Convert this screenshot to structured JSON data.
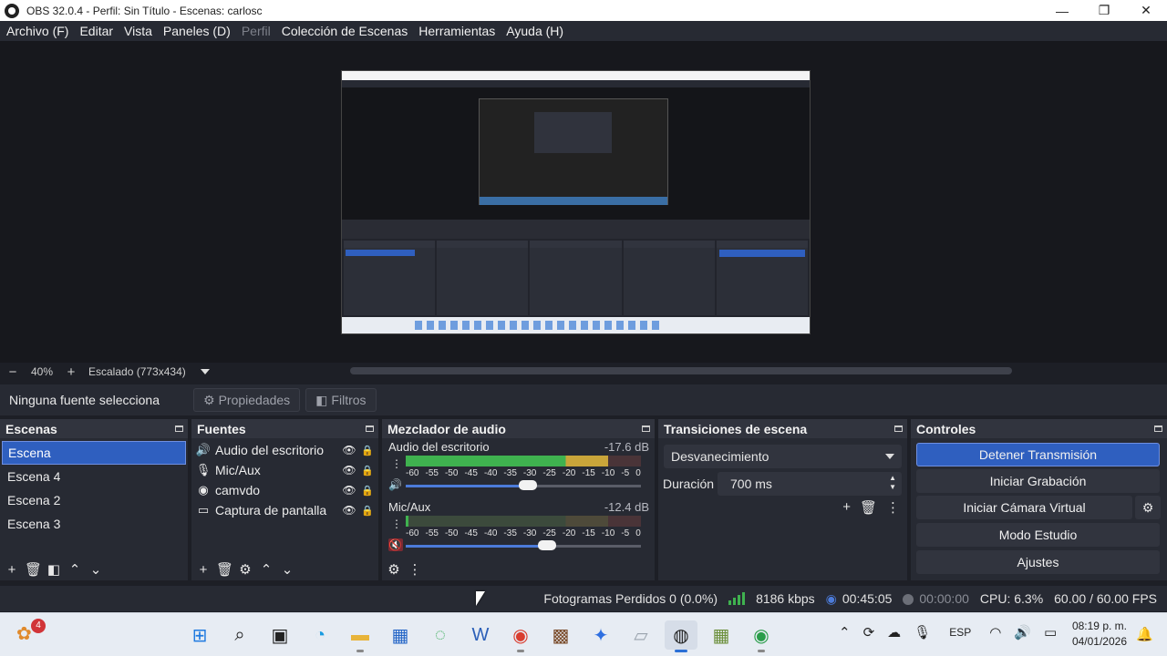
{
  "window": {
    "title": "OBS 32.0.4 - Perfil: Sin Título - Escenas: carlosc",
    "controls": [
      "—",
      "❐",
      "✕"
    ]
  },
  "menu": [
    {
      "label": "Archivo (F)",
      "enabled": true
    },
    {
      "label": "Editar",
      "enabled": true
    },
    {
      "label": "Vista",
      "enabled": true
    },
    {
      "label": "Paneles (D)",
      "enabled": true
    },
    {
      "label": "Perfil",
      "enabled": false
    },
    {
      "label": "Colección de Escenas",
      "enabled": true
    },
    {
      "label": "Herramientas",
      "enabled": true
    },
    {
      "label": "Ayuda (H)",
      "enabled": true
    }
  ],
  "zoom": {
    "minus": "−",
    "percent": "40%",
    "plus": "+",
    "scale_label": "Escalado (773x434)"
  },
  "source_toolbar": {
    "no_selection": "Ninguna fuente selecciona",
    "properties": "Propiedades",
    "filters": "Filtros"
  },
  "scenes": {
    "title": "Escenas",
    "items": [
      {
        "label": "Escena",
        "selected": true
      },
      {
        "label": "Escena 4",
        "selected": false
      },
      {
        "label": "Escena 2",
        "selected": false
      },
      {
        "label": "Escena 3",
        "selected": false
      }
    ]
  },
  "sources": {
    "title": "Fuentes",
    "items": [
      {
        "label": "Audio del escritorio",
        "icon": "speaker-icon"
      },
      {
        "label": "Mic/Aux",
        "icon": "microphone-icon"
      },
      {
        "label": "camvdo",
        "icon": "browser-icon"
      },
      {
        "label": "Captura de pantalla",
        "icon": "monitor-icon"
      }
    ]
  },
  "mixer": {
    "title": "Mezclador de audio",
    "ticks": [
      "-60",
      "-55",
      "-50",
      "-45",
      "-40",
      "-35",
      "-30",
      "-25",
      "-20",
      "-15",
      "-10",
      "-5",
      "0"
    ],
    "channels": [
      {
        "name": "Audio del escritorio",
        "db": "-17.6 dB",
        "level": 0.86,
        "volume": 0.52,
        "muted": false
      },
      {
        "name": "Mic/Aux",
        "db": "-12.4 dB",
        "level": 0.01,
        "volume": 0.6,
        "muted": true
      }
    ]
  },
  "transitions": {
    "title": "Transiciones de escena",
    "selected": "Desvanecimiento",
    "duration_label": "Duración",
    "duration_value": "700 ms"
  },
  "controls": {
    "title": "Controles",
    "stop_stream": "Detener Transmisión",
    "start_recording": "Iniciar Grabación",
    "start_virtual_cam": "Iniciar Cámara Virtual",
    "studio_mode": "Modo Estudio",
    "settings": "Ajustes"
  },
  "status": {
    "dropped_frames": "Fotogramas Perdidos 0 (0.0%)",
    "bitrate": "8186 kbps",
    "stream_time": "00:45:05",
    "record_time": "00:00:00",
    "cpu": "CPU: 6.3%",
    "fps": "60.00 / 60.00 FPS"
  },
  "taskbar": {
    "widget_badge": "4",
    "language": "ESP",
    "time": "08:19 p. m.",
    "date": "04/01/2026"
  },
  "colors": {
    "accent": "#2f5fbf",
    "meter_green": "#3fb24f",
    "meter_yellow": "#c9a53a",
    "meter_red": "#c83a4a"
  }
}
